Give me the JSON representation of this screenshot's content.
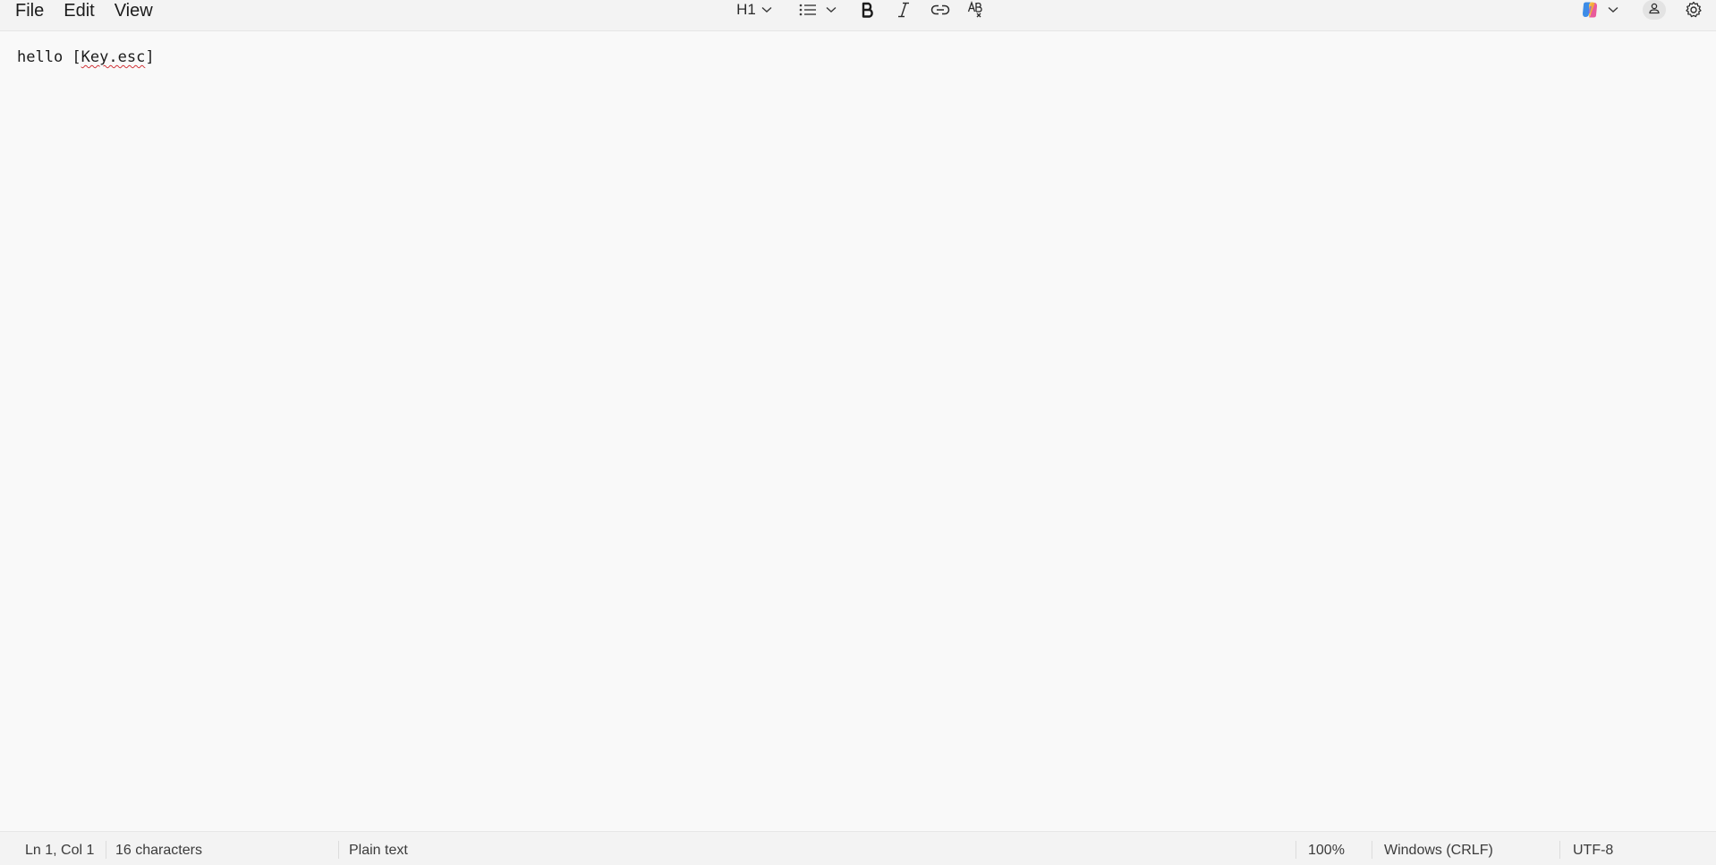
{
  "menu": {
    "file": "File",
    "edit": "Edit",
    "view": "View"
  },
  "toolbar": {
    "heading_label": "H1",
    "icons": {
      "heading_dropdown": "chevron-down-icon",
      "list": "list-icon",
      "list_dropdown": "chevron-down-icon",
      "bold": "bold-icon",
      "italic": "italic-icon",
      "link": "link-icon",
      "clear_format": "clear-formatting-icon",
      "copilot": "copilot-icon",
      "account": "account-icon",
      "settings": "gear-icon"
    }
  },
  "editor": {
    "text_before": "hello [",
    "misspelled": "Key.esc",
    "text_after": "]"
  },
  "status": {
    "position": "Ln 1, Col 1",
    "characters": "16 characters",
    "format": "Plain text",
    "zoom": "100%",
    "line_ending": "Windows (CRLF)",
    "encoding": "UTF-8"
  },
  "colors": {
    "background": "#f9f9f9",
    "bar": "#f3f3f3",
    "spell_error": "#d13438"
  }
}
